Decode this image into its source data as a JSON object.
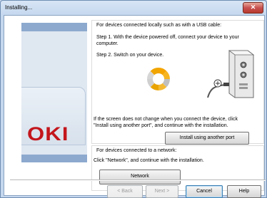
{
  "window": {
    "title": "Installing...",
    "close_glyph": "✕"
  },
  "usb_section": {
    "heading": "For devices connected locally such as with a USB cable:",
    "step1_line1": "Step 1. With the device powered off, connect your device to your",
    "step1_line2": "computer.",
    "step2": "Step 2. Switch on your device.",
    "note_line1": "If the screen does not change when you connect the device, click",
    "note_line2": "\"Install using another port\", and continue with the installation.",
    "button": "Install using another port"
  },
  "network_section": {
    "heading": "For devices connected to a network:",
    "instruction": "Click \"Network\", and continue with the installation.",
    "button": "Network"
  },
  "logo": {
    "text": "OKI",
    "color": "#c3161c"
  },
  "footer": {
    "back": "< Back",
    "next": "Next >",
    "cancel": "Cancel",
    "help": "Help"
  },
  "icons": {
    "spinner": "loading-spinner-icon",
    "pc": "pc-usb-connection-illustration"
  }
}
